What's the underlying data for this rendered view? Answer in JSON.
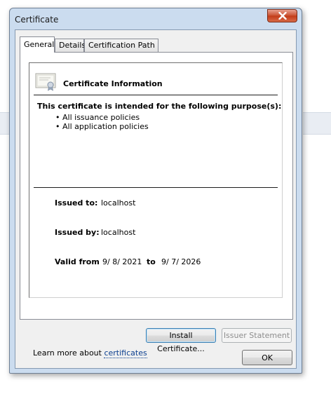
{
  "window": {
    "title": "Certificate",
    "close_icon": "close-x-icon"
  },
  "tabs": [
    {
      "label": "General",
      "active": true
    },
    {
      "label": "Details",
      "active": false
    },
    {
      "label": "Certification Path",
      "active": false
    }
  ],
  "certificate": {
    "icon": "certificate-icon",
    "heading": "Certificate Information",
    "purpose_title": "This certificate is intended for the following purpose(s):",
    "purposes": [
      "All issuance policies",
      "All application policies"
    ],
    "issued_to_label": "Issued to:",
    "issued_to_value": "localhost",
    "issued_by_label": "Issued by:",
    "issued_by_value": "localhost",
    "valid_from_label": "Valid from",
    "valid_from_value": "9/ 8/ 2021",
    "valid_to_label": "to",
    "valid_to_value": "9/ 7/ 2026"
  },
  "buttons": {
    "install": "Install Certificate...",
    "issuer_statement": "Issuer Statement",
    "ok": "OK"
  },
  "learn_more": {
    "prefix": "Learn more about ",
    "link": "certificates"
  },
  "colors": {
    "window_frame": "#cbdcef",
    "close_button": "#c9502f",
    "link": "#0b3f8f"
  }
}
